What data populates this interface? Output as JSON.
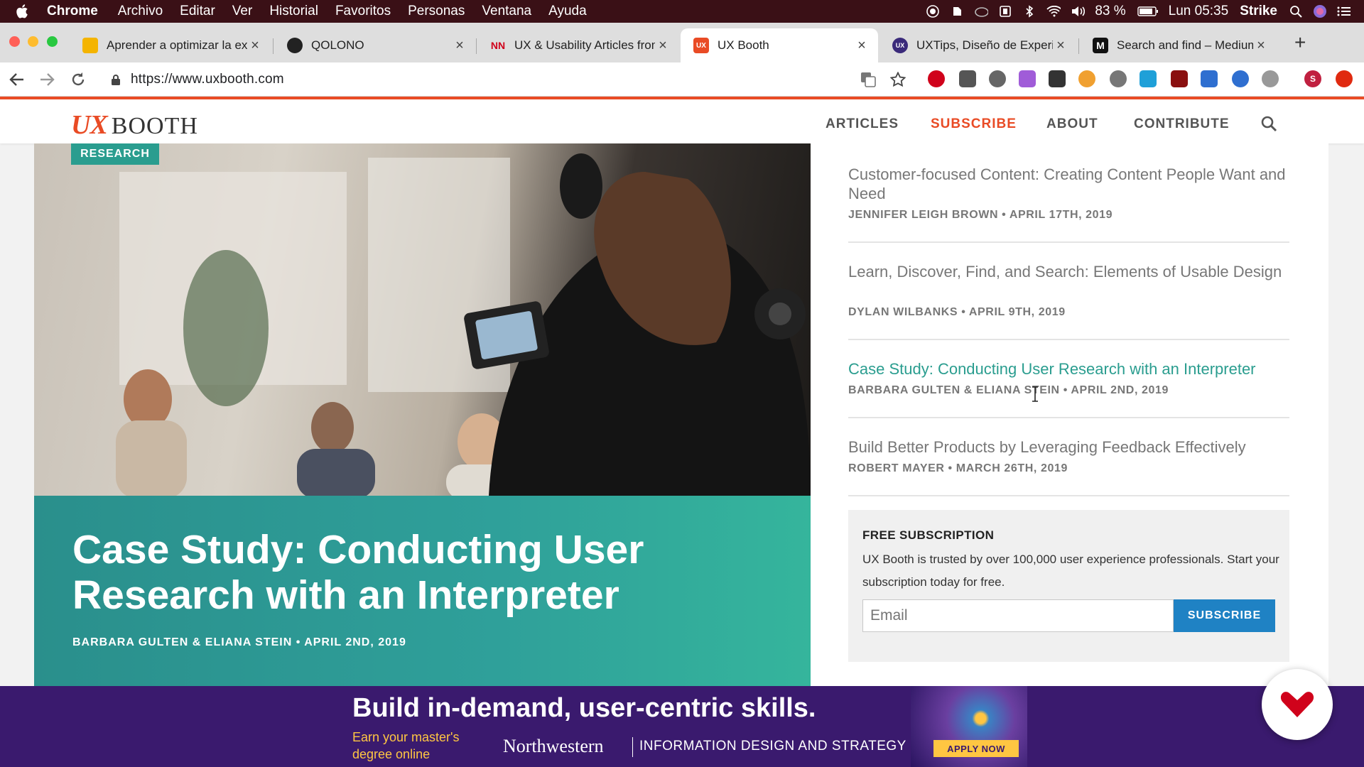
{
  "menubar": {
    "app_name": "Chrome",
    "items": [
      "Archivo",
      "Editar",
      "Ver",
      "Historial",
      "Favoritos",
      "Personas",
      "Ventana",
      "Ayuda"
    ],
    "battery": "83 %",
    "clock": "Lun 05:35",
    "user": "Strike"
  },
  "tabs": [
    {
      "title": "Aprender a optimizar la experiencia",
      "favicon_color": "#f4b400"
    },
    {
      "title": "QOLONO",
      "favicon_color": "#222222"
    },
    {
      "title": "UX & Usability Articles from Nielsen Norman Group",
      "favicon_letter": "NN",
      "favicon_color": "#d0021b"
    },
    {
      "title": "UX Booth",
      "favicon_letter": "UX",
      "favicon_color": "#e94b25"
    },
    {
      "title": "UXTips, Diseño de Experiencia",
      "favicon_letter": "UX",
      "favicon_color": "#3a2a7a"
    },
    {
      "title": "Search and find – Medium",
      "favicon_letter": "M",
      "favicon_color": "#111111"
    }
  ],
  "address_bar": {
    "url": "https://www.uxbooth.com"
  },
  "site": {
    "logo_ux": "UX",
    "logo_booth": "BOOTH",
    "nav": {
      "articles": "ARTICLES",
      "subscribe": "SUBSCRIBE",
      "about": "ABOUT",
      "contribute": "CONTRIBUTE"
    },
    "accent_color": "#e94b25"
  },
  "hero": {
    "category": "RESEARCH",
    "title": "Case Study: Conducting User Research with an Interpreter",
    "meta": "BARBARA GULTEN & ELIANA STEIN • APRIL 2ND, 2019"
  },
  "articles": [
    {
      "title": "Customer-focused Content: Creating Content People Want and Need",
      "meta": "JENNIFER LEIGH BROWN • APRIL 17TH, 2019"
    },
    {
      "title": "Learn, Discover, Find, and Search: Elements of Usable Design",
      "meta": "DYLAN WILBANKS • APRIL 9TH, 2019"
    },
    {
      "title": "Case Study: Conducting User Research with an Interpreter",
      "meta": "BARBARA GULTEN & ELIANA STEIN • APRIL 2ND, 2019"
    },
    {
      "title": "Build Better Products by Leveraging Feedback Effectively",
      "meta": "ROBERT MAYER • MARCH 26TH, 2019"
    }
  ],
  "subscription": {
    "heading": "FREE SUBSCRIPTION",
    "description": "UX Booth is trusted by over 100,000 user experience professionals. Start your subscription today for free.",
    "email_placeholder": "Email",
    "button": "SUBSCRIBE"
  },
  "banner": {
    "headline": "Build in-demand, user-centric skills.",
    "sub_line1": "Earn your master's",
    "sub_line2": "degree online",
    "university": "Northwestern",
    "program": "INFORMATION DESIGN AND STRATEGY",
    "cta": "APPLY NOW"
  }
}
